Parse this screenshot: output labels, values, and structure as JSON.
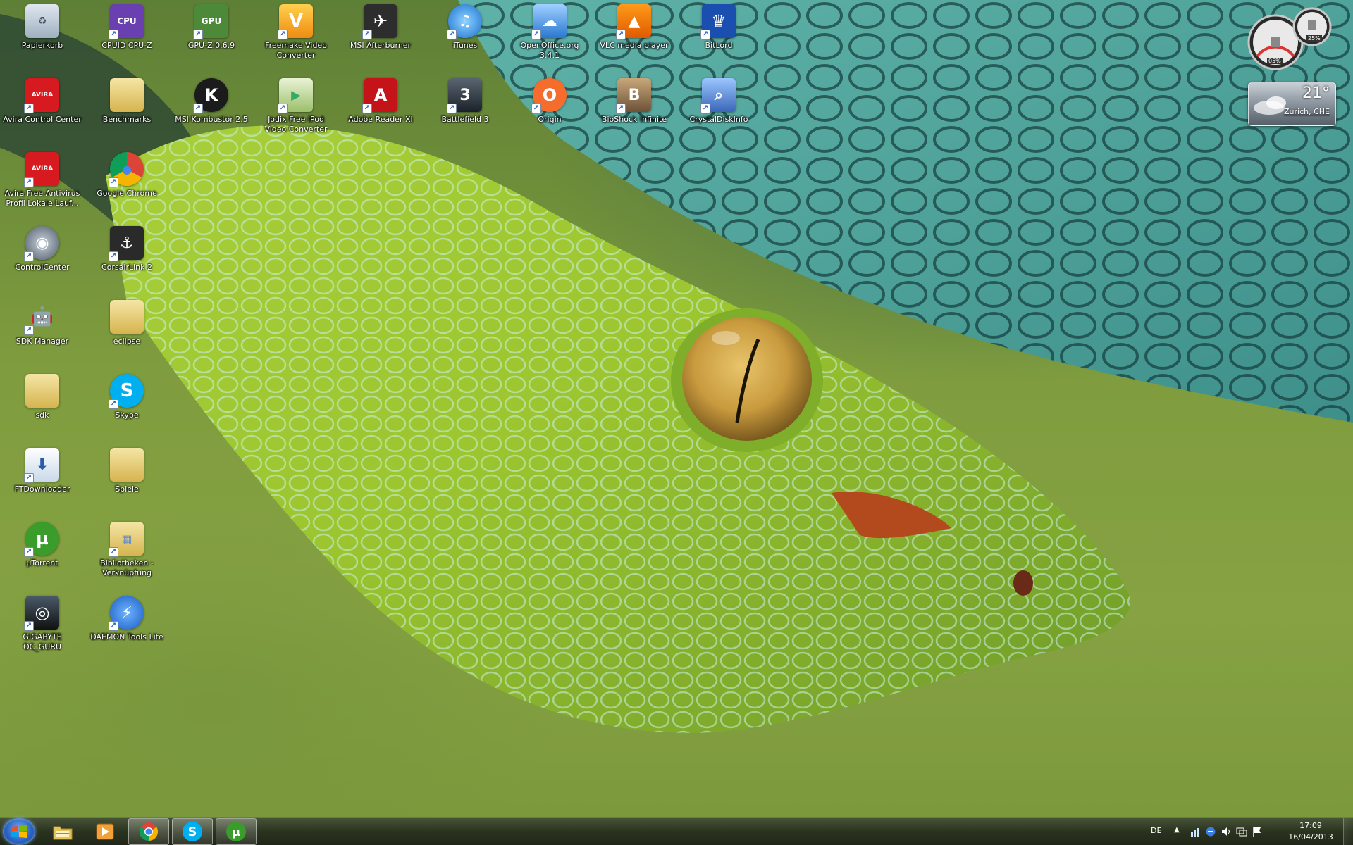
{
  "desktop": {
    "icons": [
      {
        "label": "Papierkorb",
        "icon": "recycle-bin-icon"
      },
      {
        "label": "CPUID CPU-Z",
        "icon": "cpuz-icon"
      },
      {
        "label": "GPU-Z.0.6.9",
        "icon": "gpuz-icon"
      },
      {
        "label": "Freemake Video Converter",
        "icon": "freemake-icon"
      },
      {
        "label": "MSI Afterburner",
        "icon": "afterburner-icon"
      },
      {
        "label": "iTunes",
        "icon": "itunes-icon"
      },
      {
        "label": "OpenOffice.org 3.4.1",
        "icon": "openoffice-icon"
      },
      {
        "label": "VLC media player",
        "icon": "vlc-icon"
      },
      {
        "label": "BitLord",
        "icon": "bitlord-icon"
      },
      {
        "label": "Avira Control Center",
        "icon": "avira-icon"
      },
      {
        "label": "Benchmarks",
        "icon": "folder-icon"
      },
      {
        "label": "MSI Kombustor 2.5",
        "icon": "kombustor-icon"
      },
      {
        "label": "Jodix Free iPod Video Converter",
        "icon": "jodix-icon"
      },
      {
        "label": "Adobe Reader XI",
        "icon": "adobe-reader-icon"
      },
      {
        "label": "Battlefield 3",
        "icon": "battlefield-icon"
      },
      {
        "label": "Origin",
        "icon": "origin-icon"
      },
      {
        "label": "BioShock Infinite",
        "icon": "bioshock-icon"
      },
      {
        "label": "CrystalDiskInfo",
        "icon": "crystaldiskinfo-icon"
      },
      {
        "label": "Avira Free Antivirus Profil Lokale Lauf...",
        "icon": "avira-icon"
      },
      {
        "label": "Google Chrome",
        "icon": "chrome-icon"
      },
      {
        "label": "ControlCenter",
        "icon": "controlcenter-icon"
      },
      {
        "label": "CorsairLink 2",
        "icon": "corsairlink-icon"
      },
      {
        "label": "SDK Manager",
        "icon": "android-icon"
      },
      {
        "label": "eclipse",
        "icon": "folder-icon"
      },
      {
        "label": "sdk",
        "icon": "folder-icon"
      },
      {
        "label": "Skype",
        "icon": "skype-icon"
      },
      {
        "label": "FTDownloader",
        "icon": "ftdownloader-icon"
      },
      {
        "label": "Spiele",
        "icon": "folder-icon"
      },
      {
        "label": "µTorrent",
        "icon": "utorrent-icon"
      },
      {
        "label": "Bibliotheken - Verknüpfung",
        "icon": "libraries-icon"
      },
      {
        "label": "GIGABYTE OC_GURU",
        "icon": "oc-guru-icon"
      },
      {
        "label": "DAEMON Tools Lite",
        "icon": "daemon-tools-icon"
      }
    ]
  },
  "gadgets": {
    "meter": {
      "cpu": "05%",
      "ram": "25%"
    },
    "weather": {
      "temperature": "21°",
      "location": "Zurich, CHE"
    }
  },
  "taskbar": {
    "pinned": [
      {
        "name": "explorer",
        "icon": "explorer-icon",
        "active": false
      },
      {
        "name": "media-player",
        "icon": "media-player-icon",
        "active": false
      },
      {
        "name": "chrome",
        "icon": "chrome-icon",
        "active": true
      },
      {
        "name": "skype",
        "icon": "skype-icon",
        "active": true
      },
      {
        "name": "utorrent",
        "icon": "utorrent-icon",
        "active": true
      }
    ],
    "tray": {
      "language": "DE",
      "expand_icon": "▲",
      "time": "17:09",
      "date": "16/04/2013"
    }
  },
  "colors": {
    "avira": "#d71920",
    "skype": "#00aff0",
    "utorrent": "#3a9c2b",
    "chrome_red": "#db4437",
    "chrome_yellow": "#f4b400",
    "chrome_green": "#0f9d58",
    "chrome_blue": "#4285f4"
  }
}
